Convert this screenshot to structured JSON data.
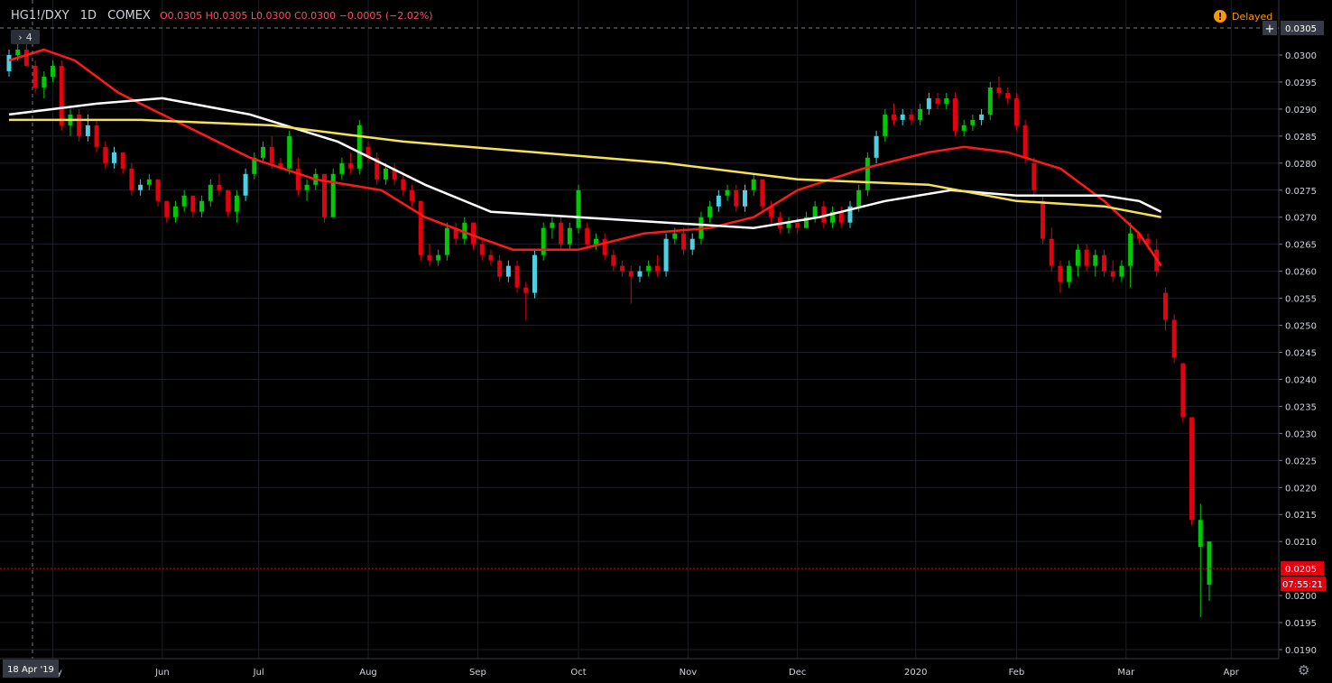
{
  "header": {
    "symbol": "HG1!/DXY",
    "interval": "1D",
    "exchange": "COMEX",
    "ohlc": "O0.0305  H0.0305  L0.0300  C0.0300  −0.0005 (−2.02%)"
  },
  "delayed_label": "Delayed",
  "collapse_label": "4",
  "price_labels": {
    "top": "0.0305",
    "last": "0.0205",
    "countdown": "07:55:21"
  },
  "colors": {
    "up": "#00c805",
    "up_alt": "#4dd0e1",
    "down": "#e3000f",
    "ma_red": "#ff1a1a",
    "ma_white": "#ffffff",
    "ma_yellow": "#f5e154",
    "grid": "#1c1f26",
    "axis_text": "#d1d4dc"
  },
  "chart_data": {
    "type": "line",
    "title": "HG1!/DXY 1D COMEX",
    "xlabel": "",
    "ylabel": "",
    "ylim": [
      0.0188,
      0.0308
    ],
    "y_ticks": [
      "0.0300",
      "0.0295",
      "0.0290",
      "0.0285",
      "0.0280",
      "0.0275",
      "0.0270",
      "0.0265",
      "0.0260",
      "0.0255",
      "0.0250",
      "0.0245",
      "0.0240",
      "0.0235",
      "0.0230",
      "0.0225",
      "0.0220",
      "0.0215",
      "0.0210",
      "0.0200",
      "0.0195",
      "0.0190"
    ],
    "x_ticks": [
      "May",
      "Jun",
      "Jul",
      "Aug",
      "Sep",
      "Oct",
      "Nov",
      "Dec",
      "2020",
      "Feb",
      "Mar",
      "Apr"
    ],
    "crosshair_date": "18 Apr '19",
    "series": [
      {
        "key": "ma50",
        "color": "ma_red",
        "values": [
          [
            0,
            0.0299
          ],
          [
            8,
            0.0301
          ],
          [
            15,
            0.0299
          ],
          [
            25,
            0.0293
          ],
          [
            40,
            0.0287
          ],
          [
            55,
            0.0281
          ],
          [
            70,
            0.0277
          ],
          [
            85,
            0.0275
          ],
          [
            95,
            0.027
          ],
          [
            108,
            0.0266
          ],
          [
            115,
            0.0264
          ],
          [
            130,
            0.0264
          ],
          [
            145,
            0.0267
          ],
          [
            160,
            0.0268
          ],
          [
            170,
            0.027
          ],
          [
            180,
            0.0275
          ],
          [
            195,
            0.0279
          ],
          [
            210,
            0.0282
          ],
          [
            218,
            0.0283
          ],
          [
            228,
            0.0282
          ],
          [
            240,
            0.0279
          ],
          [
            250,
            0.0273
          ],
          [
            258,
            0.0267
          ],
          [
            263,
            0.0261
          ]
        ]
      },
      {
        "key": "ma100",
        "color": "ma_white",
        "values": [
          [
            0,
            0.0289
          ],
          [
            20,
            0.0291
          ],
          [
            35,
            0.0292
          ],
          [
            55,
            0.0289
          ],
          [
            75,
            0.0284
          ],
          [
            95,
            0.0276
          ],
          [
            110,
            0.0271
          ],
          [
            130,
            0.027
          ],
          [
            150,
            0.0269
          ],
          [
            170,
            0.0268
          ],
          [
            185,
            0.027
          ],
          [
            200,
            0.0273
          ],
          [
            215,
            0.0275
          ],
          [
            230,
            0.0274
          ],
          [
            250,
            0.0274
          ],
          [
            258,
            0.0273
          ],
          [
            263,
            0.0271
          ]
        ]
      },
      {
        "key": "ma200",
        "color": "ma_yellow",
        "values": [
          [
            0,
            0.0288
          ],
          [
            30,
            0.0288
          ],
          [
            60,
            0.0287
          ],
          [
            90,
            0.0284
          ],
          [
            120,
            0.0282
          ],
          [
            150,
            0.028
          ],
          [
            180,
            0.0277
          ],
          [
            210,
            0.0276
          ],
          [
            230,
            0.0273
          ],
          [
            250,
            0.0272
          ],
          [
            263,
            0.027
          ]
        ]
      }
    ],
    "candles_note": "daily OHLC candles, index = trading day from 2019-04-18",
    "candles": [
      [
        0,
        0.0297,
        0.0301,
        0.0296,
        0.03
      ],
      [
        2,
        0.03,
        0.0304,
        0.0299,
        0.0301
      ],
      [
        4,
        0.0301,
        0.0302,
        0.0298,
        0.0298
      ],
      [
        6,
        0.0298,
        0.0299,
        0.0293,
        0.0294
      ],
      [
        8,
        0.0294,
        0.0297,
        0.0292,
        0.0296
      ],
      [
        10,
        0.0296,
        0.0299,
        0.0295,
        0.0298
      ],
      [
        12,
        0.0298,
        0.0299,
        0.0286,
        0.0287
      ],
      [
        14,
        0.0287,
        0.029,
        0.0285,
        0.0289
      ],
      [
        16,
        0.0289,
        0.029,
        0.0284,
        0.0285
      ],
      [
        18,
        0.0285,
        0.0289,
        0.0284,
        0.0287
      ],
      [
        20,
        0.0287,
        0.0288,
        0.0282,
        0.0283
      ],
      [
        22,
        0.0283,
        0.0284,
        0.0279,
        0.028
      ],
      [
        24,
        0.028,
        0.0283,
        0.0279,
        0.0282
      ],
      [
        26,
        0.0282,
        0.0282,
        0.0278,
        0.0279
      ],
      [
        28,
        0.0279,
        0.028,
        0.0274,
        0.0275
      ],
      [
        30,
        0.0275,
        0.0277,
        0.0274,
        0.0276
      ],
      [
        32,
        0.0276,
        0.0278,
        0.0275,
        0.0277
      ],
      [
        34,
        0.0277,
        0.0277,
        0.0272,
        0.0273
      ],
      [
        36,
        0.0273,
        0.0273,
        0.0269,
        0.027
      ],
      [
        38,
        0.027,
        0.0273,
        0.0269,
        0.0272
      ],
      [
        40,
        0.0272,
        0.0275,
        0.0271,
        0.0274
      ],
      [
        42,
        0.0274,
        0.0274,
        0.027,
        0.0271
      ],
      [
        44,
        0.0271,
        0.0274,
        0.027,
        0.0273
      ],
      [
        46,
        0.0273,
        0.0277,
        0.0272,
        0.0276
      ],
      [
        48,
        0.0276,
        0.0278,
        0.0274,
        0.0275
      ],
      [
        50,
        0.0275,
        0.0275,
        0.027,
        0.0271
      ],
      [
        52,
        0.0271,
        0.0275,
        0.0269,
        0.0274
      ],
      [
        54,
        0.0274,
        0.0279,
        0.0273,
        0.0278
      ],
      [
        56,
        0.0278,
        0.0282,
        0.0277,
        0.0281
      ],
      [
        58,
        0.0281,
        0.0284,
        0.028,
        0.0283
      ],
      [
        60,
        0.0283,
        0.0285,
        0.0279,
        0.028
      ],
      [
        62,
        0.028,
        0.0281,
        0.0279,
        0.0279
      ],
      [
        64,
        0.0279,
        0.0286,
        0.0278,
        0.0285
      ],
      [
        66,
        0.0279,
        0.0281,
        0.0274,
        0.0275
      ],
      [
        68,
        0.0275,
        0.0277,
        0.0273,
        0.0276
      ],
      [
        70,
        0.0276,
        0.0279,
        0.0275,
        0.0278
      ],
      [
        72,
        0.0278,
        0.0278,
        0.0269,
        0.027
      ],
      [
        74,
        0.027,
        0.0279,
        0.027,
        0.0278
      ],
      [
        76,
        0.0278,
        0.0281,
        0.0277,
        0.028
      ],
      [
        78,
        0.028,
        0.0282,
        0.0278,
        0.0279
      ],
      [
        80,
        0.0279,
        0.0288,
        0.0278,
        0.0287
      ],
      [
        82,
        0.0283,
        0.0284,
        0.028,
        0.0281
      ],
      [
        84,
        0.0281,
        0.0282,
        0.0276,
        0.0277
      ],
      [
        86,
        0.0277,
        0.028,
        0.0276,
        0.0279
      ],
      [
        88,
        0.0279,
        0.028,
        0.0276,
        0.0277
      ],
      [
        90,
        0.0277,
        0.0278,
        0.0274,
        0.0275
      ],
      [
        92,
        0.0275,
        0.0276,
        0.0272,
        0.0273
      ],
      [
        94,
        0.0273,
        0.0273,
        0.0262,
        0.0263
      ],
      [
        96,
        0.0263,
        0.0265,
        0.0261,
        0.0262
      ],
      [
        98,
        0.0262,
        0.0264,
        0.0261,
        0.0263
      ],
      [
        100,
        0.0263,
        0.0269,
        0.0262,
        0.0268
      ],
      [
        102,
        0.0268,
        0.0269,
        0.0265,
        0.0266
      ],
      [
        104,
        0.0266,
        0.027,
        0.0265,
        0.0269
      ],
      [
        106,
        0.0269,
        0.0269,
        0.0264,
        0.0265
      ],
      [
        108,
        0.0265,
        0.0266,
        0.0262,
        0.0263
      ],
      [
        110,
        0.0263,
        0.0264,
        0.0261,
        0.0262
      ],
      [
        112,
        0.0262,
        0.0263,
        0.0258,
        0.0259
      ],
      [
        114,
        0.0259,
        0.0262,
        0.0258,
        0.0261
      ],
      [
        116,
        0.0261,
        0.0262,
        0.0256,
        0.0257
      ],
      [
        118,
        0.0257,
        0.0258,
        0.0251,
        0.0256
      ],
      [
        120,
        0.0256,
        0.0264,
        0.0255,
        0.0263
      ],
      [
        122,
        0.0263,
        0.0269,
        0.0262,
        0.0268
      ],
      [
        124,
        0.0268,
        0.027,
        0.0266,
        0.0269
      ],
      [
        126,
        0.0269,
        0.027,
        0.0264,
        0.0265
      ],
      [
        128,
        0.0265,
        0.0269,
        0.0264,
        0.0268
      ],
      [
        130,
        0.0268,
        0.0276,
        0.0267,
        0.0275
      ],
      [
        132,
        0.0268,
        0.0269,
        0.0264,
        0.0265
      ],
      [
        134,
        0.0265,
        0.0267,
        0.0264,
        0.0266
      ],
      [
        136,
        0.0266,
        0.0267,
        0.0262,
        0.0263
      ],
      [
        138,
        0.0263,
        0.0264,
        0.026,
        0.0261
      ],
      [
        140,
        0.0261,
        0.0262,
        0.0259,
        0.026
      ],
      [
        142,
        0.026,
        0.0261,
        0.0254,
        0.0259
      ],
      [
        144,
        0.0259,
        0.0261,
        0.0258,
        0.026
      ],
      [
        146,
        0.026,
        0.0262,
        0.0259,
        0.0261
      ],
      [
        148,
        0.0261,
        0.0263,
        0.0259,
        0.026
      ],
      [
        150,
        0.026,
        0.0267,
        0.0259,
        0.0266
      ],
      [
        152,
        0.0266,
        0.0268,
        0.0265,
        0.0267
      ],
      [
        154,
        0.0267,
        0.0268,
        0.0263,
        0.0264
      ],
      [
        156,
        0.0264,
        0.0267,
        0.0263,
        0.0266
      ],
      [
        158,
        0.0266,
        0.0271,
        0.0265,
        0.027
      ],
      [
        160,
        0.027,
        0.0273,
        0.0269,
        0.0272
      ],
      [
        162,
        0.0272,
        0.0275,
        0.0271,
        0.0274
      ],
      [
        164,
        0.0274,
        0.0276,
        0.0273,
        0.0275
      ],
      [
        166,
        0.0275,
        0.0276,
        0.0271,
        0.0272
      ],
      [
        168,
        0.0272,
        0.0276,
        0.0271,
        0.0275
      ],
      [
        170,
        0.0275,
        0.0278,
        0.0274,
        0.0277
      ],
      [
        172,
        0.0277,
        0.0277,
        0.0271,
        0.0272
      ],
      [
        174,
        0.0272,
        0.0273,
        0.0269,
        0.027
      ],
      [
        176,
        0.027,
        0.0271,
        0.0267,
        0.0268
      ],
      [
        178,
        0.0268,
        0.027,
        0.0267,
        0.0269
      ],
      [
        180,
        0.0269,
        0.027,
        0.0267,
        0.0268
      ],
      [
        182,
        0.0268,
        0.0271,
        0.0268,
        0.027
      ],
      [
        184,
        0.027,
        0.0273,
        0.0269,
        0.0272
      ],
      [
        186,
        0.0272,
        0.0273,
        0.0268,
        0.0269
      ],
      [
        188,
        0.0269,
        0.0272,
        0.0268,
        0.0271
      ],
      [
        190,
        0.0271,
        0.0272,
        0.0268,
        0.0269
      ],
      [
        192,
        0.0269,
        0.0273,
        0.0268,
        0.0272
      ],
      [
        194,
        0.0272,
        0.0276,
        0.0271,
        0.0275
      ],
      [
        196,
        0.0275,
        0.0282,
        0.0274,
        0.0281
      ],
      [
        198,
        0.0281,
        0.0286,
        0.028,
        0.0285
      ],
      [
        200,
        0.0285,
        0.029,
        0.0284,
        0.0289
      ],
      [
        202,
        0.0289,
        0.0291,
        0.0287,
        0.0288
      ],
      [
        204,
        0.0288,
        0.029,
        0.0287,
        0.0289
      ],
      [
        206,
        0.0289,
        0.029,
        0.0287,
        0.0288
      ],
      [
        208,
        0.0288,
        0.0291,
        0.0287,
        0.029
      ],
      [
        210,
        0.029,
        0.0293,
        0.0289,
        0.0292
      ],
      [
        212,
        0.0292,
        0.0293,
        0.029,
        0.0291
      ],
      [
        214,
        0.0291,
        0.0293,
        0.029,
        0.0292
      ],
      [
        216,
        0.0292,
        0.0293,
        0.0285,
        0.0286
      ],
      [
        218,
        0.0286,
        0.0288,
        0.0285,
        0.0287
      ],
      [
        220,
        0.0287,
        0.0289,
        0.0286,
        0.0288
      ],
      [
        222,
        0.0288,
        0.029,
        0.0287,
        0.0289
      ],
      [
        224,
        0.0289,
        0.0295,
        0.0288,
        0.0294
      ],
      [
        226,
        0.0294,
        0.0296,
        0.0292,
        0.0293
      ],
      [
        228,
        0.0293,
        0.0294,
        0.0291,
        0.0292
      ],
      [
        230,
        0.0292,
        0.0293,
        0.0286,
        0.0287
      ],
      [
        232,
        0.0287,
        0.0288,
        0.028,
        0.0281
      ],
      [
        234,
        0.028,
        0.0281,
        0.0274,
        0.0275
      ],
      [
        236,
        0.0273,
        0.0274,
        0.0265,
        0.0266
      ],
      [
        238,
        0.0266,
        0.0268,
        0.026,
        0.0261
      ],
      [
        240,
        0.0261,
        0.0262,
        0.0256,
        0.0258
      ],
      [
        242,
        0.0258,
        0.0262,
        0.0257,
        0.0261
      ],
      [
        244,
        0.0261,
        0.0265,
        0.0259,
        0.0264
      ],
      [
        246,
        0.0264,
        0.0265,
        0.026,
        0.0261
      ],
      [
        248,
        0.0261,
        0.0264,
        0.0259,
        0.0263
      ],
      [
        250,
        0.0263,
        0.0264,
        0.0259,
        0.026
      ],
      [
        252,
        0.026,
        0.0262,
        0.0258,
        0.0259
      ],
      [
        254,
        0.0259,
        0.0262,
        0.0258,
        0.0261
      ],
      [
        256,
        0.0261,
        0.0269,
        0.0257,
        0.0267
      ],
      [
        258,
        0.0267,
        0.0267,
        0.0265,
        0.0266
      ],
      [
        260,
        0.0266,
        0.0267,
        0.0264,
        0.0265
      ],
      [
        262,
        0.0264,
        0.0266,
        0.0259,
        0.026
      ],
      [
        264,
        0.0256,
        0.0257,
        0.0249,
        0.0251
      ],
      [
        266,
        0.0251,
        0.0252,
        0.0243,
        0.0244
      ],
      [
        268,
        0.0243,
        0.0243,
        0.0232,
        0.0233
      ],
      [
        270,
        0.0233,
        0.0233,
        0.0213,
        0.0214
      ],
      [
        272,
        0.0209,
        0.0217,
        0.0196,
        0.0214
      ],
      [
        274,
        0.0202,
        0.021,
        0.0199,
        0.021
      ]
    ]
  }
}
